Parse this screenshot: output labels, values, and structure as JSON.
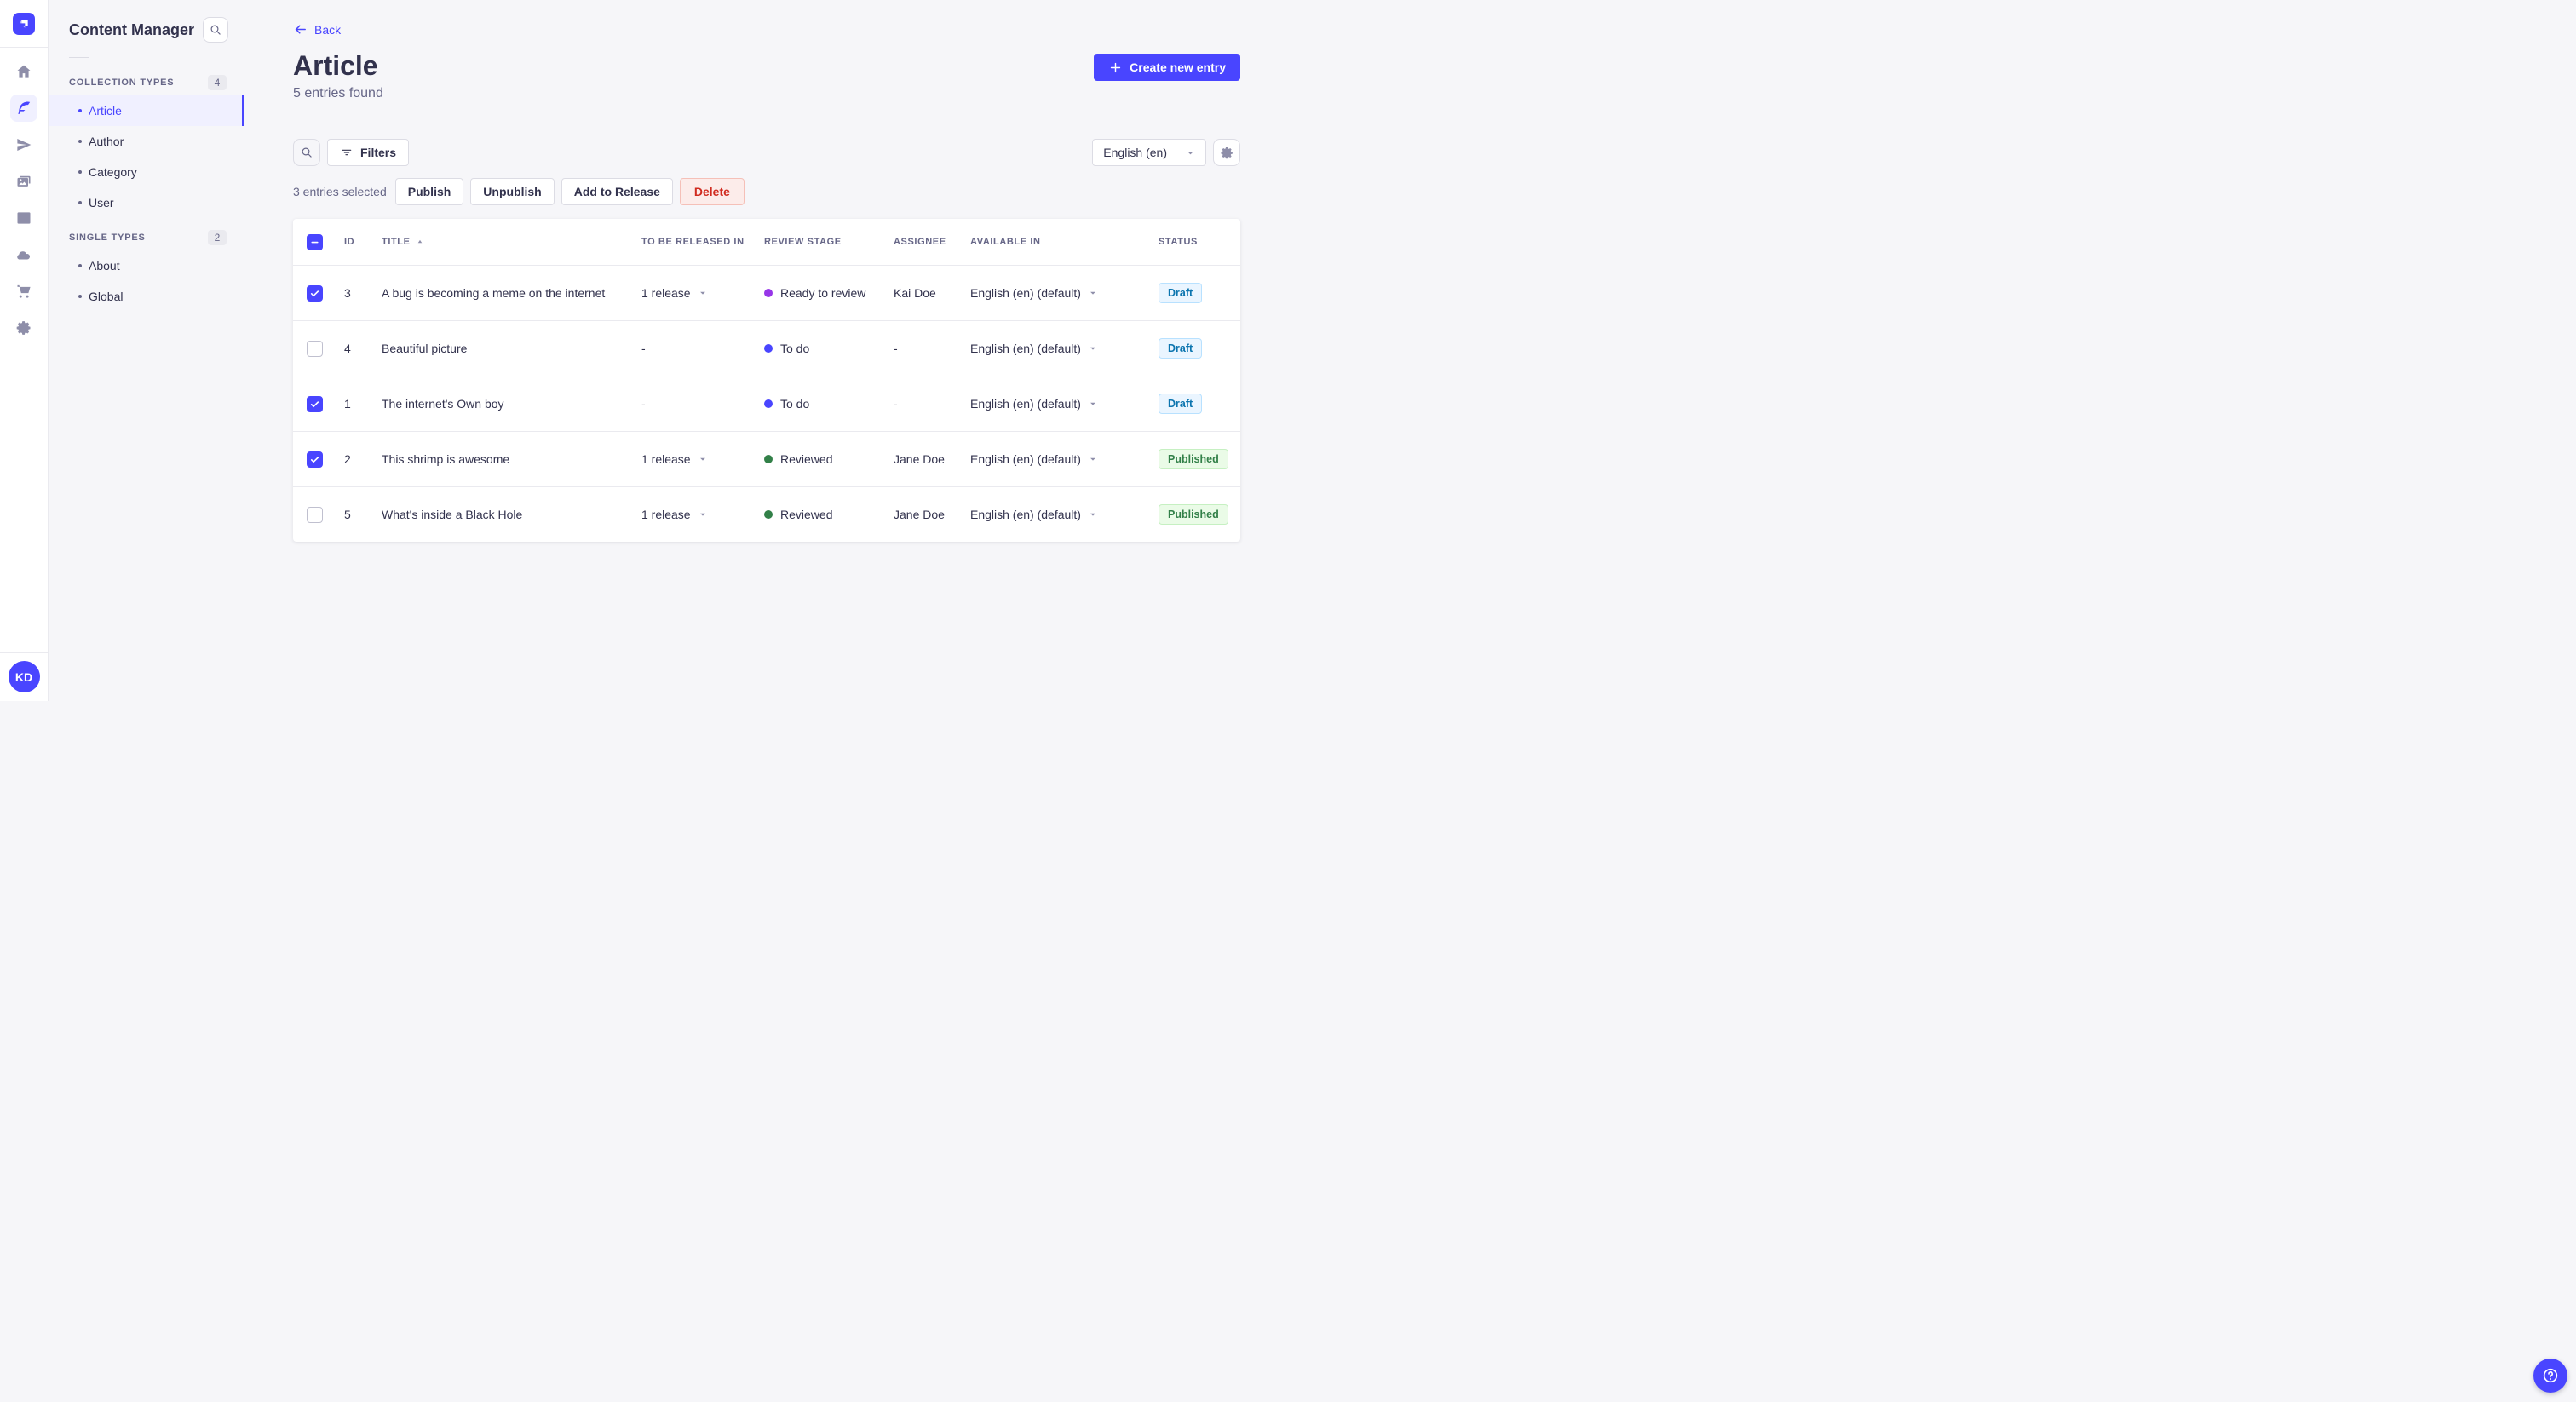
{
  "colors": {
    "primary": "#4945ff",
    "page_bg": "#f6f6f9",
    "draft_badge": {
      "bg": "#eaf5ff",
      "border": "#b8e1ff",
      "text": "#0c75af"
    },
    "published_badge": {
      "bg": "#eafbe7",
      "border": "#c6f0c2",
      "text": "#328048"
    },
    "stage_todo": "#4945ff",
    "stage_ready_to_review": "#9736e8",
    "stage_reviewed": "#328048"
  },
  "nav": {
    "avatar_initials": "KD",
    "items": [
      {
        "icon": "home-icon",
        "active": false
      },
      {
        "icon": "content-manager-icon",
        "active": true
      },
      {
        "icon": "releases-icon",
        "active": false
      },
      {
        "icon": "media-library-icon",
        "active": false
      },
      {
        "icon": "content-type-builder-icon",
        "active": false
      },
      {
        "icon": "deploy-icon",
        "active": false
      },
      {
        "icon": "marketplace-icon",
        "active": false
      },
      {
        "icon": "settings-icon",
        "active": false
      }
    ]
  },
  "subnav": {
    "title": "Content Manager",
    "sections": [
      {
        "label": "COLLECTION TYPES",
        "count": "4",
        "items": [
          {
            "label": "Article",
            "active": true
          },
          {
            "label": "Author",
            "active": false
          },
          {
            "label": "Category",
            "active": false
          },
          {
            "label": "User",
            "active": false
          }
        ]
      },
      {
        "label": "SINGLE TYPES",
        "count": "2",
        "items": [
          {
            "label": "About",
            "active": false
          },
          {
            "label": "Global",
            "active": false
          }
        ]
      }
    ]
  },
  "header": {
    "back_label": "Back",
    "title": "Article",
    "subtitle": "5 entries found",
    "create_button": "Create new entry"
  },
  "toolbar": {
    "filters_label": "Filters",
    "locale_value": "English (en)"
  },
  "selection": {
    "text": "3 entries selected",
    "publish": "Publish",
    "unpublish": "Unpublish",
    "add_to_release": "Add to Release",
    "delete": "Delete"
  },
  "table": {
    "headers": [
      "ID",
      "TITLE",
      "TO BE RELEASED IN",
      "REVIEW STAGE",
      "ASSIGNEE",
      "AVAILABLE IN",
      "STATUS"
    ],
    "sorted_by": "TITLE",
    "sort_direction": "asc",
    "rows": [
      {
        "checked": true,
        "id": "3",
        "title": "A bug is becoming a meme on the internet",
        "release": "1 release",
        "has_release": true,
        "stage": "Ready to review",
        "stage_color": "#9736e8",
        "assignee": "Kai Doe",
        "locale": "English (en) (default)",
        "status": "Draft"
      },
      {
        "checked": false,
        "id": "4",
        "title": "Beautiful picture",
        "release": "-",
        "has_release": false,
        "stage": "To do",
        "stage_color": "#4945ff",
        "assignee": "-",
        "locale": "English (en) (default)",
        "status": "Draft"
      },
      {
        "checked": true,
        "id": "1",
        "title": "The internet's Own boy",
        "release": "-",
        "has_release": false,
        "stage": "To do",
        "stage_color": "#4945ff",
        "assignee": "-",
        "locale": "English (en) (default)",
        "status": "Draft"
      },
      {
        "checked": true,
        "id": "2",
        "title": "This shrimp is awesome",
        "release": "1 release",
        "has_release": true,
        "stage": "Reviewed",
        "stage_color": "#328048",
        "assignee": "Jane Doe",
        "locale": "English (en) (default)",
        "status": "Published"
      },
      {
        "checked": false,
        "id": "5",
        "title": "What's inside a Black Hole",
        "release": "1 release",
        "has_release": true,
        "stage": "Reviewed",
        "stage_color": "#328048",
        "assignee": "Jane Doe",
        "locale": "English (en) (default)",
        "status": "Published"
      }
    ],
    "status_styles": {
      "Draft": {
        "bg": "#eaf5ff",
        "border": "#b8e1ff",
        "text": "#0c75af"
      },
      "Published": {
        "bg": "#eafbe7",
        "border": "#c6f0c2",
        "text": "#328048"
      }
    }
  }
}
